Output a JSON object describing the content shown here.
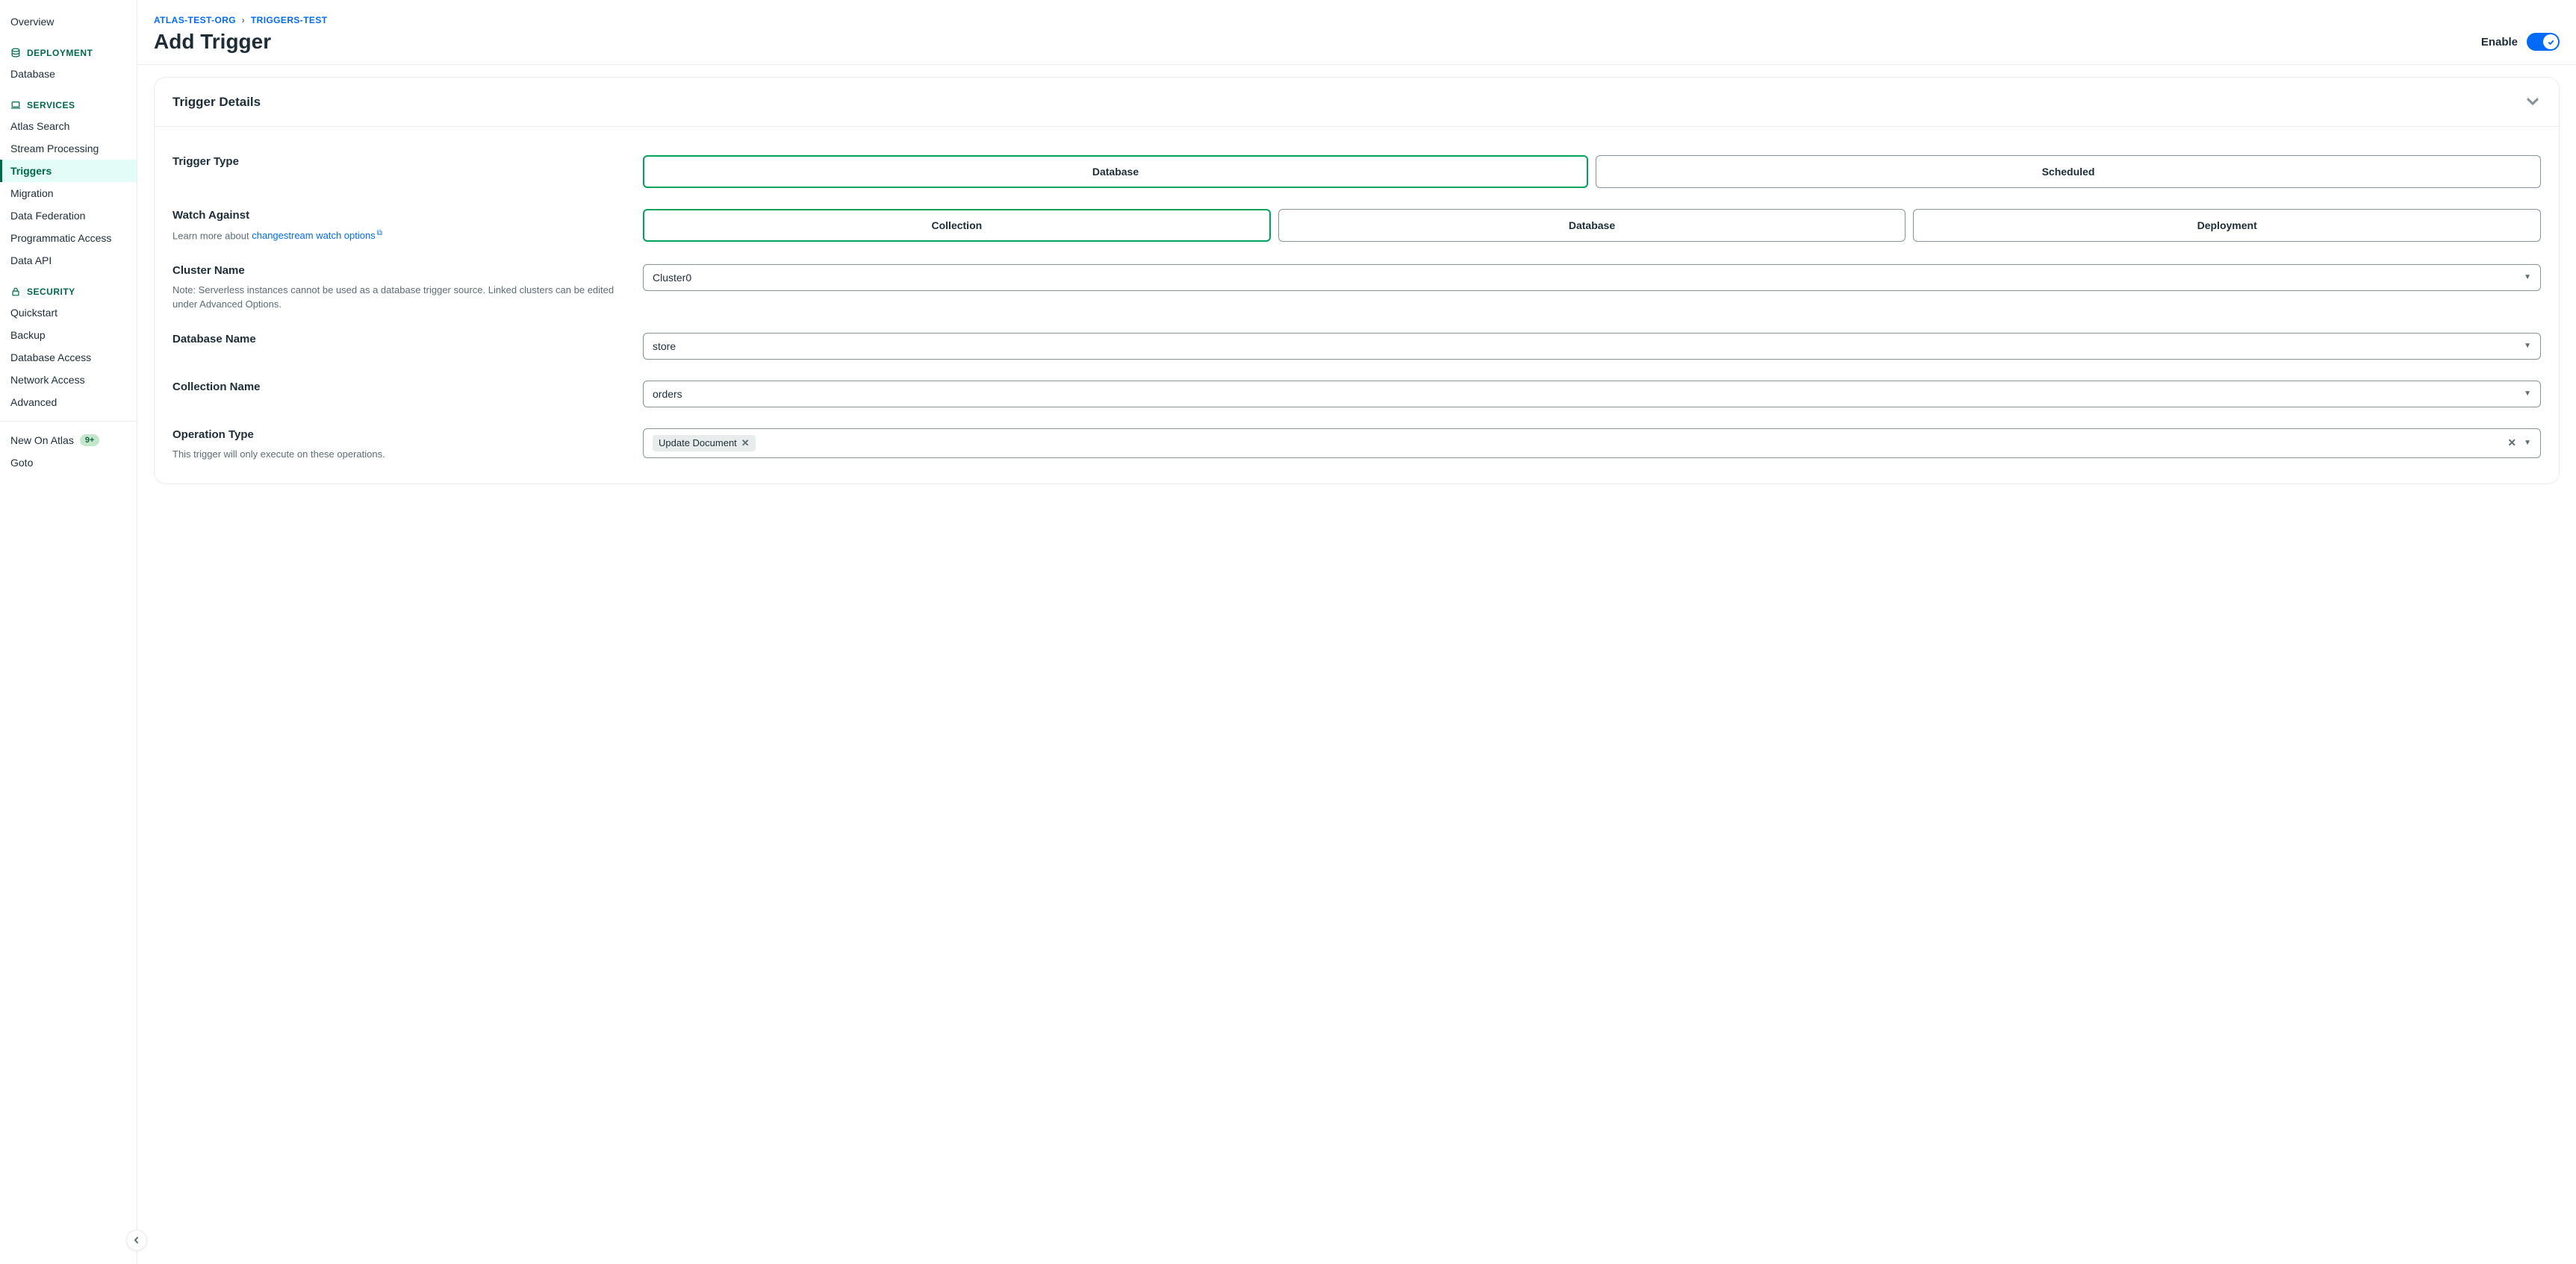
{
  "sidebar": {
    "overview": "Overview",
    "sections": {
      "deployment": {
        "label": "DEPLOYMENT",
        "items": [
          "Database"
        ]
      },
      "services": {
        "label": "SERVICES",
        "items": [
          "Atlas Search",
          "Stream Processing",
          "Triggers",
          "Migration",
          "Data Federation",
          "Programmatic Access",
          "Data API"
        ],
        "active": "Triggers"
      },
      "security": {
        "label": "SECURITY",
        "items": [
          "Quickstart",
          "Backup",
          "Database Access",
          "Network Access",
          "Advanced"
        ]
      }
    },
    "bottom": {
      "new_on_atlas": "New On Atlas",
      "new_badge": "9+",
      "goto": "Goto"
    }
  },
  "breadcrumb": {
    "org": "ATLAS-TEST-ORG",
    "project": "TRIGGERS-TEST"
  },
  "page_title": "Add Trigger",
  "enable": {
    "label": "Enable",
    "on": true
  },
  "card": {
    "title": "Trigger Details"
  },
  "form": {
    "trigger_type": {
      "label": "Trigger Type",
      "options": [
        "Database",
        "Scheduled"
      ],
      "selected": "Database"
    },
    "watch_against": {
      "label": "Watch Against",
      "help_prefix": "Learn more about ",
      "help_link": "changestream watch options",
      "options": [
        "Collection",
        "Database",
        "Deployment"
      ],
      "selected": "Collection"
    },
    "cluster": {
      "label": "Cluster Name",
      "help": "Note: Serverless instances cannot be used as a database trigger source. Linked clusters can be edited under Advanced Options.",
      "value": "Cluster0"
    },
    "database": {
      "label": "Database Name",
      "value": "store"
    },
    "collection": {
      "label": "Collection Name",
      "value": "orders"
    },
    "operation": {
      "label": "Operation Type",
      "help": "This trigger will only execute on these operations.",
      "chips": [
        "Update Document"
      ]
    }
  }
}
